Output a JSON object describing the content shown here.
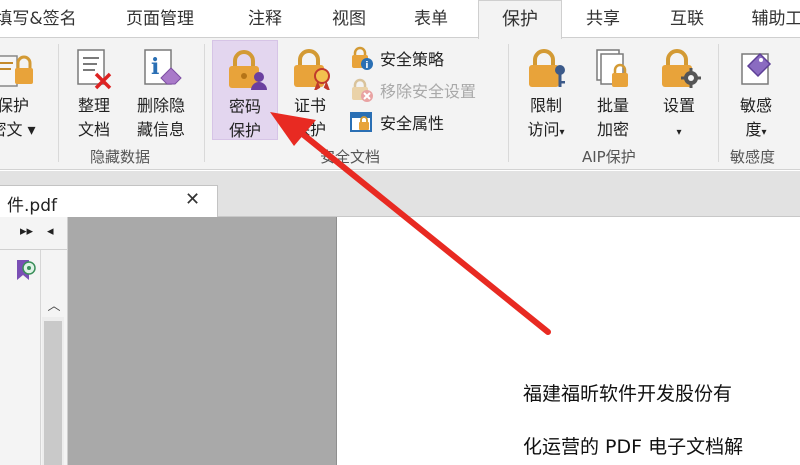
{
  "tabs": [
    {
      "label": "填写&签名"
    },
    {
      "label": "页面管理"
    },
    {
      "label": "注释"
    },
    {
      "label": "视图"
    },
    {
      "label": "表单"
    },
    {
      "label": "保护"
    },
    {
      "label": "共享"
    },
    {
      "label": "互联"
    },
    {
      "label": "辅助工"
    }
  ],
  "active_tab": "保护",
  "ribbon": {
    "protect_doc": {
      "line1": "保护",
      "line2": "密文 ▾"
    },
    "organize_doc": {
      "line1": "整理",
      "line2": "文档"
    },
    "delete_hidden": {
      "line1": "删除隐",
      "line2": "藏信息"
    },
    "group_hidden_data": "隐藏数据",
    "password_protect": {
      "line1": "密码",
      "line2": "保护"
    },
    "cert_protect": {
      "line1": "证书",
      "line2": "保护"
    },
    "security_policy": "安全策略",
    "remove_security": "移除安全设置",
    "security_properties": "安全属性",
    "group_secure_doc": "安全文档",
    "restrict_access": {
      "line1": "限制",
      "line2": "访问"
    },
    "batch_encrypt": {
      "line1": "批量",
      "line2": "加密"
    },
    "settings": {
      "line1": "设置"
    },
    "group_aip": "AIP保护",
    "sensitivity": {
      "line1": "敏感",
      "line2": "度"
    },
    "group_sensitivity": "敏感度"
  },
  "doc_tab": {
    "name": "件.pdf",
    "close": "✕"
  },
  "nav": {
    "expand": "▸▸",
    "collapse": "◂",
    "scroll_up": "︿"
  },
  "page_text": [
    "福建福昕软件开发股份有",
    "化运营的 PDF 电子文档解"
  ],
  "colors": {
    "accent": "#e3d6ef",
    "lock_gold": "#e8a33a",
    "arrow_red": "#e82a22",
    "gray_area": "#a9a9a9"
  },
  "icons": [
    "protect-lock-icon",
    "organize-doc-icon",
    "delete-hidden-info-icon",
    "password-protect-icon",
    "certificate-protect-icon",
    "security-policy-icon",
    "remove-security-icon",
    "security-properties-icon",
    "restrict-access-icon",
    "batch-encrypt-icon",
    "settings-gear-icon",
    "sensitivity-tag-icon",
    "bookmark-icon"
  ]
}
